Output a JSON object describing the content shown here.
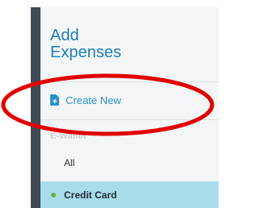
{
  "sidebar": {
    "title_line1": "Add",
    "title_line2": "Expenses",
    "create_label": "Create New",
    "section_label": "E-Wallet",
    "items": [
      {
        "label": "All"
      },
      {
        "label": "Credit Card",
        "active": true
      }
    ]
  },
  "icons": {
    "create": "document-plus-icon",
    "active_indicator": "status-dot-icon"
  },
  "colors": {
    "title": "#1f7fb7",
    "link": "#2a92c8",
    "active_bg": "#a9dce9",
    "active_dot": "#6bb04e",
    "annotation": "#e00000"
  }
}
